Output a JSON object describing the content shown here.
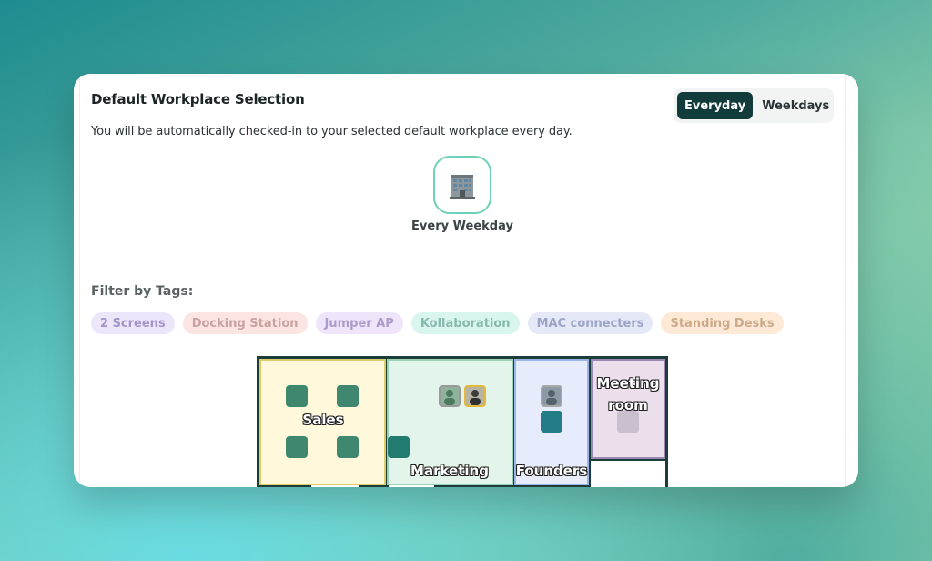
{
  "header": {
    "title": "Default Workplace Selection",
    "subtitle": "You will be automatically checked-in to your selected default workplace every day."
  },
  "toggle": {
    "options": [
      {
        "label": "Everyday",
        "active": true
      },
      {
        "label": "Weekdays",
        "active": false
      }
    ]
  },
  "workplace": {
    "icon": "office-building-icon",
    "label": "Every Weekday"
  },
  "filter": {
    "label": "Filter by Tags:",
    "tags": [
      {
        "label": "2 Screens",
        "bg": "#ece6fb",
        "color": "#a296c8"
      },
      {
        "label": "Docking Station",
        "bg": "#fbe4e2",
        "color": "#c9a3a0"
      },
      {
        "label": "Jumper AP",
        "bg": "#efe5fa",
        "color": "#ad9cc8"
      },
      {
        "label": "Kollaboration",
        "bg": "#d9f6ee",
        "color": "#86b9ab"
      },
      {
        "label": "MAC connecters",
        "bg": "#e4e8f7",
        "color": "#9ba4c4"
      },
      {
        "label": "Standing Desks",
        "bg": "#fde9d5",
        "color": "#ccaa8a"
      }
    ]
  },
  "floorplan": {
    "rooms": [
      {
        "label": "Sales"
      },
      {
        "label": "Marketing"
      },
      {
        "label": "Founders"
      },
      {
        "label": "Meeting room"
      }
    ]
  },
  "colors": {
    "accent_dark": "#123c3b",
    "accent_teal": "#6fd1b7",
    "desk_green": "#3f876f"
  }
}
